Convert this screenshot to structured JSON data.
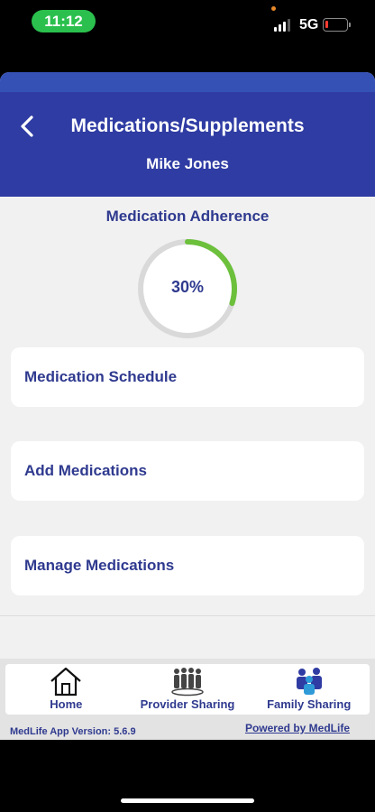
{
  "status_bar": {
    "time": "11:12",
    "network": "5G",
    "battery_level": 0.1,
    "battery_color": "#ff3b30",
    "time_pill_color": "#2bc04e"
  },
  "header": {
    "title": "Medications/Supplements",
    "subtitle": "Mike Jones",
    "back_icon": "chevron-left-icon",
    "color": "#2f3ca3"
  },
  "adherence": {
    "title": "Medication Adherence",
    "value_label": "30%",
    "value": 0.3,
    "progress_color": "#6cc03c",
    "track_color": "#d9d9d9"
  },
  "cards": [
    {
      "label": "Medication Schedule"
    },
    {
      "label": "Add Medications"
    },
    {
      "label": "Manage Medications"
    }
  ],
  "bottom_nav": {
    "items": [
      {
        "label": "Home",
        "icon": "home-icon"
      },
      {
        "label": "Provider Sharing",
        "icon": "provider-sharing-icon"
      },
      {
        "label": "Family Sharing",
        "icon": "family-sharing-icon"
      }
    ]
  },
  "footer": {
    "version": "MedLife App Version: 5.6.9",
    "powered_by": "Powered by MedLife"
  },
  "theme": {
    "text_color": "#2f3a8f",
    "background": "#f1f1f1"
  }
}
